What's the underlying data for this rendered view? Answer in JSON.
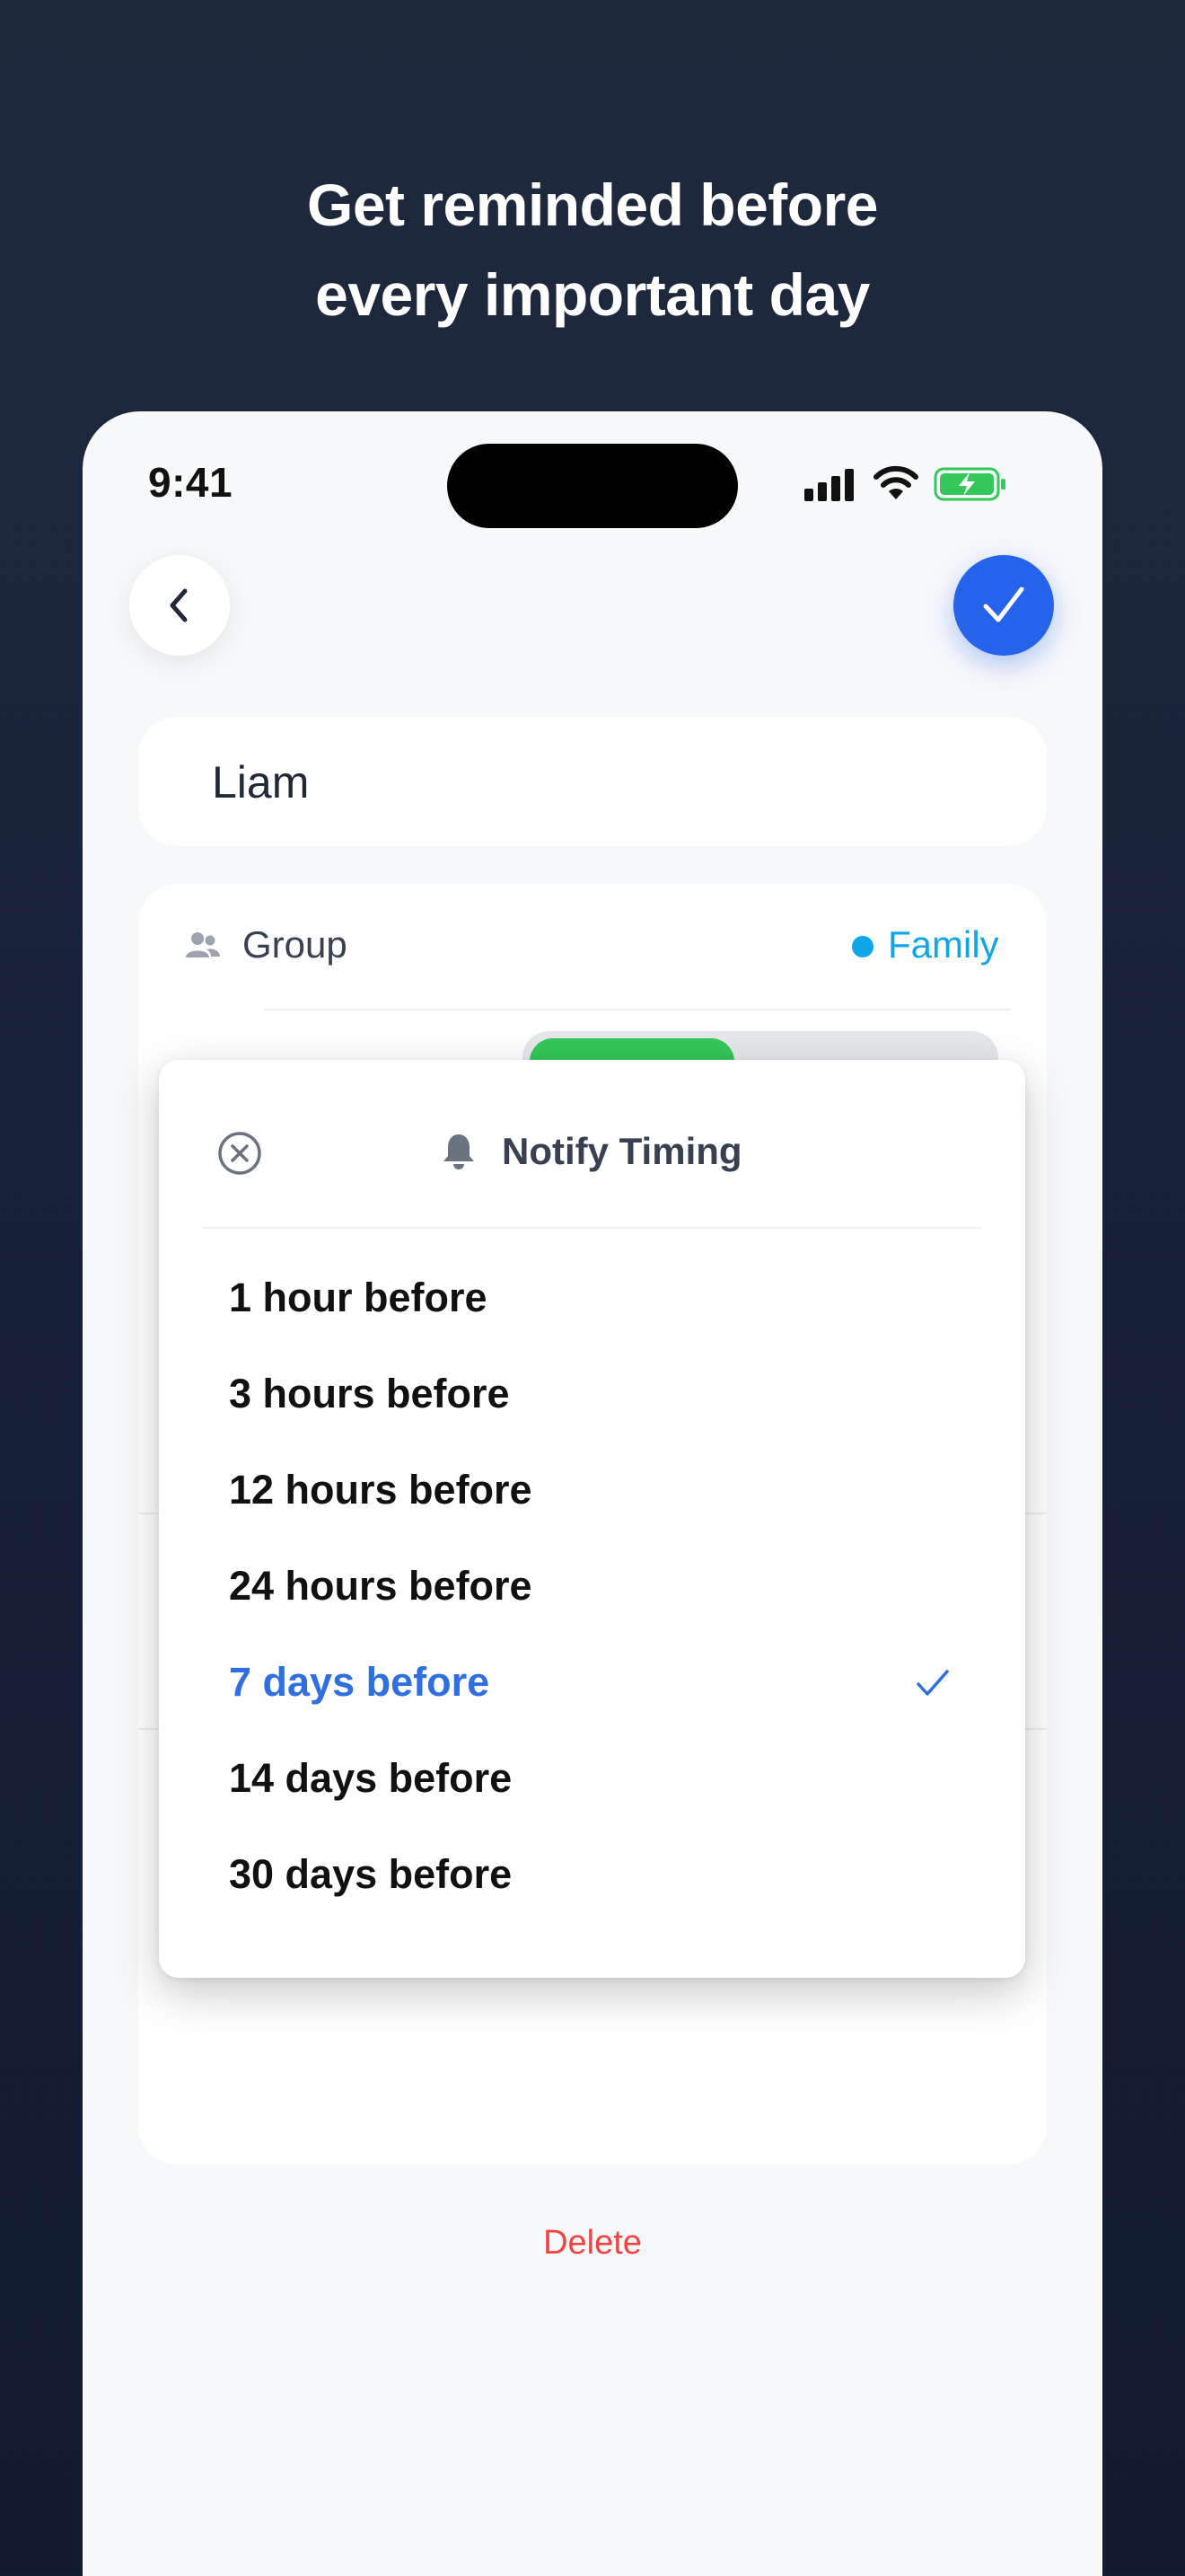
{
  "headline": {
    "line1": "Get reminded before",
    "line2": "every important day"
  },
  "status_bar": {
    "time": "9:41"
  },
  "header": {
    "back_icon": "chevron-left-icon",
    "confirm_icon": "checkmark-icon",
    "accent": "#2563eb"
  },
  "contact": {
    "name": "Liam"
  },
  "settings": {
    "group": {
      "label": "Group",
      "value": "Family",
      "color": "#0ea5e9"
    }
  },
  "popup": {
    "title": "Notify Timing",
    "close_icon": "close-circle-icon",
    "title_icon": "bell-icon",
    "options": [
      {
        "label": "1 hour before",
        "selected": false
      },
      {
        "label": "3 hours before",
        "selected": false
      },
      {
        "label": "12 hours before",
        "selected": false
      },
      {
        "label": "24 hours before",
        "selected": false
      },
      {
        "label": "7 days before",
        "selected": true
      },
      {
        "label": "14 days before",
        "selected": false
      },
      {
        "label": "30 days before",
        "selected": false
      }
    ]
  },
  "footer": {
    "delete_label": "Delete",
    "delete_color": "#ef4444"
  }
}
